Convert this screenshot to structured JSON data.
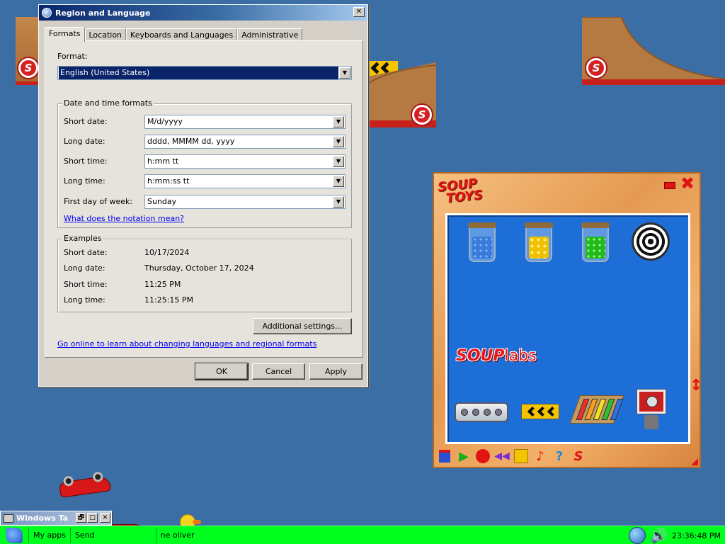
{
  "dialog": {
    "title": "Region and Language",
    "close_label": "✕",
    "tabs": [
      {
        "label": "Formats",
        "active": true
      },
      {
        "label": "Location",
        "active": false
      },
      {
        "label": "Keyboards and Languages",
        "active": false
      },
      {
        "label": "Administrative",
        "active": false
      }
    ],
    "format_label": "Format:",
    "format_value": "English (United States)",
    "datetime_group": "Date and time formats",
    "fields": [
      {
        "label": "Short date:",
        "value": "M/d/yyyy"
      },
      {
        "label": "Long date:",
        "value": "dddd, MMMM dd, yyyy"
      },
      {
        "label": "Short time:",
        "value": "h:mm tt"
      },
      {
        "label": "Long time:",
        "value": "h:mm:ss tt"
      },
      {
        "label": "First day of week:",
        "value": "Sunday"
      }
    ],
    "notation_link": "What does the notation mean?",
    "examples_group": "Examples",
    "examples": [
      {
        "label": "Short date:",
        "value": "10/17/2024"
      },
      {
        "label": "Long date:",
        "value": "Thursday, October 17, 2024"
      },
      {
        "label": "Short time:",
        "value": "11:25 PM"
      },
      {
        "label": "Long time:",
        "value": "11:25:15 PM"
      }
    ],
    "additional_settings": "Additional settings...",
    "online_link": "Go online to learn about changing languages and regional formats",
    "ok": "OK",
    "cancel": "Cancel",
    "apply": "Apply",
    "dropdown_arrow": "▼"
  },
  "soup": {
    "logo_line1": "SOUP",
    "logo_line2": "TOYS",
    "close_label": "✖",
    "souplabs_bold": "SOUP",
    "souplabs_light": "labs",
    "scroll_arrow": "↕",
    "toolbar": {
      "play": "▶",
      "rewind": "◀◀",
      "music": "♪",
      "help": "?",
      "s": "S"
    },
    "colors": {
      "accent_red": "#e01414",
      "panel_blue": "#1d6ed6"
    }
  },
  "desktop": {
    "s_logo": "S"
  },
  "mini_window": {
    "title": "Windows Ta",
    "restore": "🗗",
    "maximize": "□",
    "close": "✕"
  },
  "taskbar": {
    "items": [
      "My apps",
      "Send",
      "ne oliver"
    ],
    "clock": "23:36:48 PM",
    "volume_icon": "🔊",
    "color": "#00ff1e"
  }
}
